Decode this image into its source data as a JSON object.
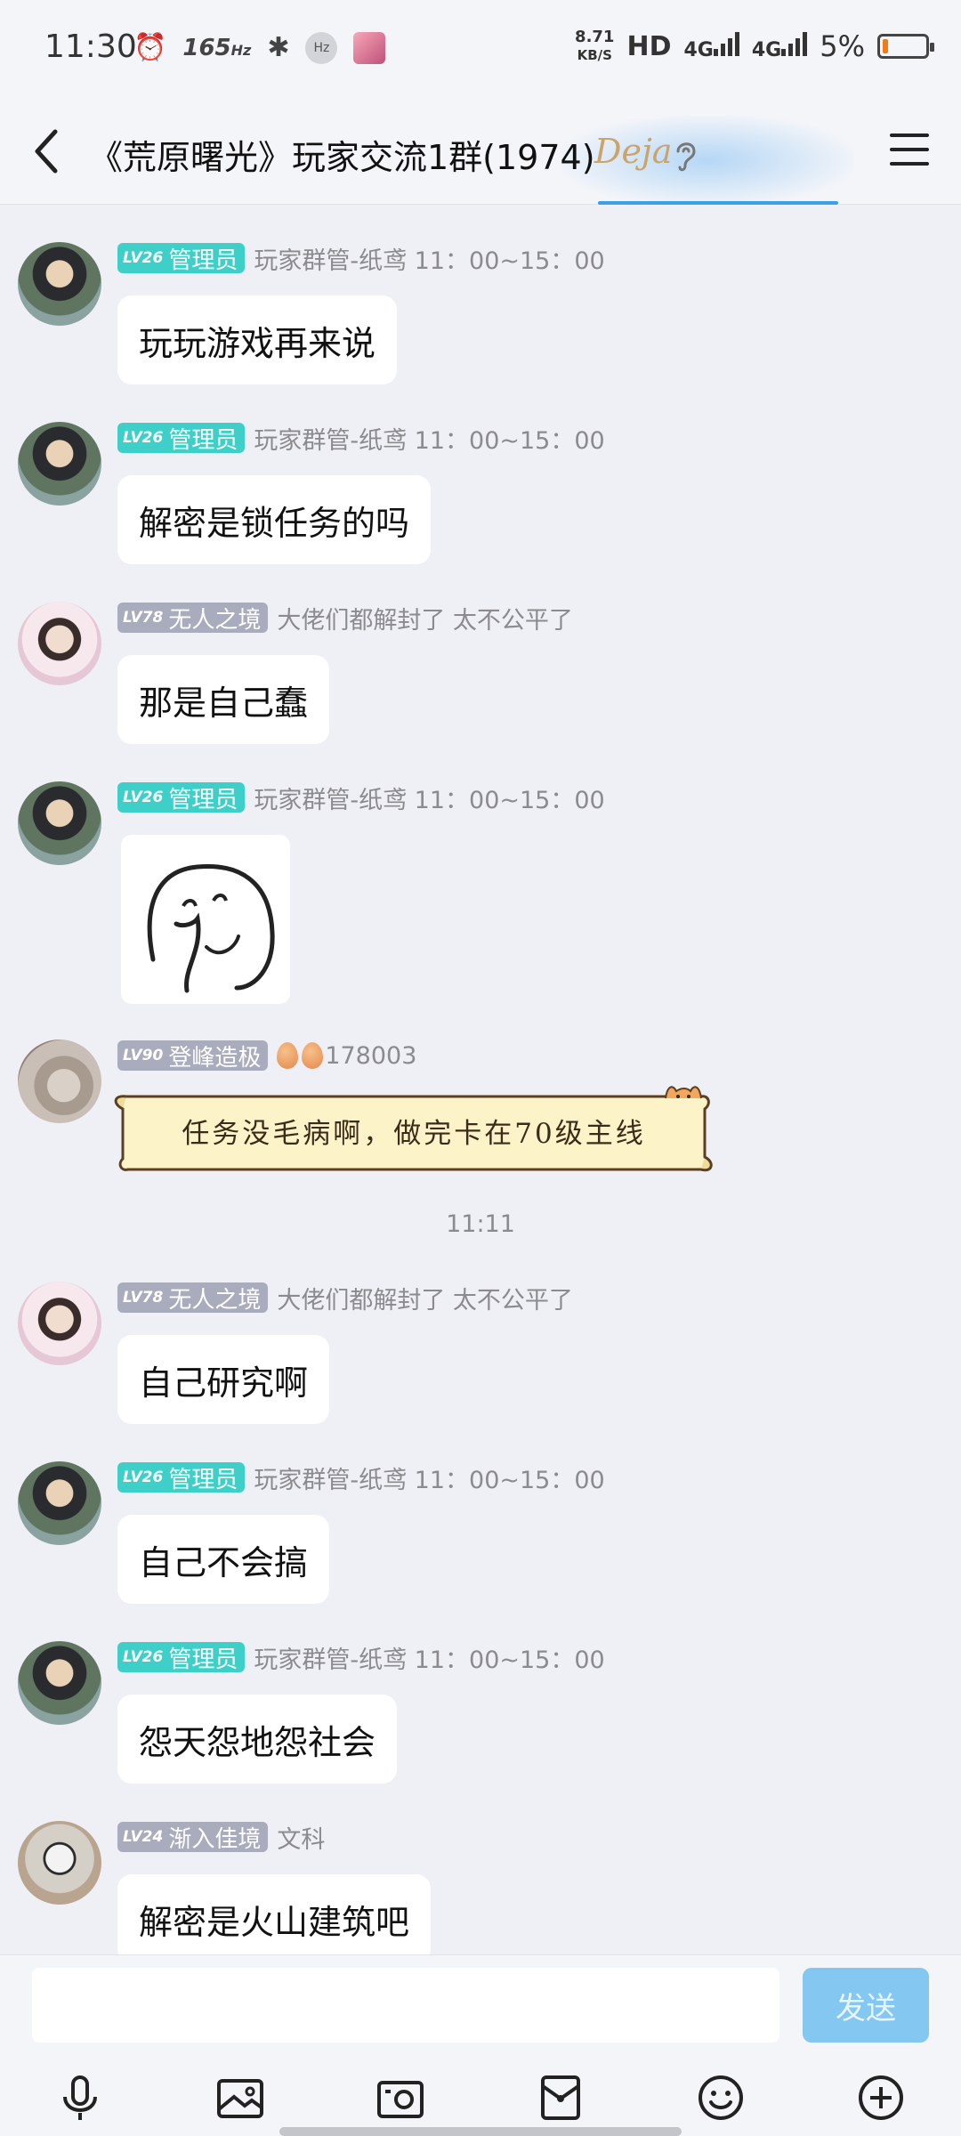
{
  "status_bar": {
    "time": "11:30",
    "refresh_rate": "165",
    "refresh_unit": "Hz",
    "hz_badge": "Hz",
    "net_speed_value": "8.71",
    "net_speed_unit": "KB/S",
    "hd_label": "HD",
    "signal_1": "4G",
    "signal_2": "4G",
    "battery_percent": "5%",
    "battery_level": 0.05,
    "battery_color": "#f07b1c"
  },
  "header": {
    "title": "《荒原曙光》玩家交流1群(1974)",
    "decoration_text": "Deja",
    "back_icon": "chevron-left-icon",
    "menu_icon": "hamburger-menu-icon"
  },
  "messages": [
    {
      "level": "LV26",
      "role": "管理员",
      "nick": "玩家群管-纸鸢 11：00~15：00",
      "text": "玩玩游戏再来说"
    },
    {
      "level": "LV26",
      "role": "管理员",
      "nick": "玩家群管-纸鸢 11：00~15：00",
      "text": "解密是锁任务的吗"
    },
    {
      "level": "LV78",
      "role": "无人之境",
      "nick": "大佬们都解封了  太不公平了",
      "text": "那是自己蠢"
    },
    {
      "level": "LV26",
      "role": "管理员",
      "nick": "玩家群管-纸鸢 11：00~15：00",
      "sticker": "sketch-sticker"
    },
    {
      "level": "LV90",
      "role": "登峰造极",
      "nick": "178003",
      "text": "任务没毛病啊，做完卡在70级主线"
    },
    {
      "level": "LV78",
      "role": "无人之境",
      "nick": "大佬们都解封了  太不公平了",
      "text": "自己研究啊"
    },
    {
      "level": "LV26",
      "role": "管理员",
      "nick": "玩家群管-纸鸢 11：00~15：00",
      "text": "自己不会搞"
    },
    {
      "level": "LV26",
      "role": "管理员",
      "nick": "玩家群管-纸鸢 11：00~15：00",
      "text": "怨天怨地怨社会"
    },
    {
      "level": "LV24",
      "role": "渐入佳境",
      "nick": "文科",
      "text": "解密是火山建筑吧"
    }
  ],
  "timestamp": "11:11",
  "input": {
    "value": "",
    "placeholder": "",
    "send_label": "发送"
  },
  "colors": {
    "admin_badge": "#3ed0c8",
    "member_badge": "#a9acbc",
    "send_button": "#84c7f1",
    "background": "#eff0f5"
  },
  "toolbar_icons": [
    "microphone-icon",
    "image-icon",
    "camera-icon",
    "red-packet-icon",
    "emoji-icon",
    "plus-icon"
  ]
}
